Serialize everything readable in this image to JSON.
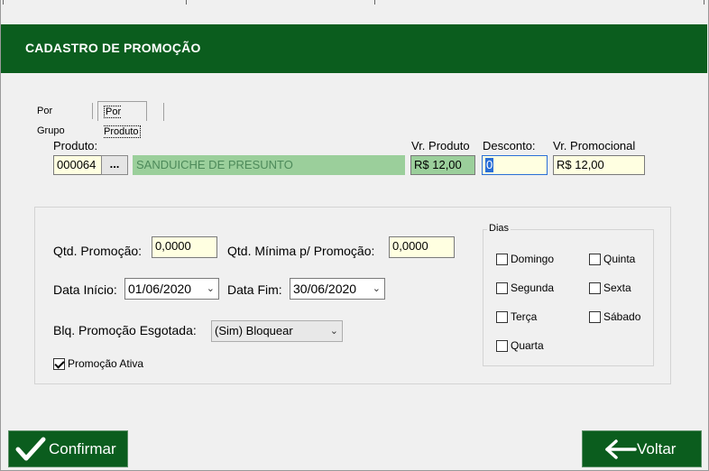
{
  "header": {
    "title": "CADASTRO DE PROMOÇÃO"
  },
  "tabs": [
    {
      "label": "Por Grupo"
    },
    {
      "label": "Por Produto"
    }
  ],
  "produto": {
    "label": "Produto:",
    "code": "000064",
    "lookup_label": "...",
    "name": "SANDUICHE DE PRESUNTO"
  },
  "vr_produto": {
    "label": "Vr. Produto",
    "value": "R$ 12,00"
  },
  "desconto": {
    "label": "Desconto:",
    "value": "0"
  },
  "vr_promocional": {
    "label": "Vr. Promocional",
    "value": "R$ 12,00"
  },
  "qtd_promocao": {
    "label": "Qtd. Promoção:",
    "value": "0,0000"
  },
  "qtd_minima": {
    "label": "Qtd. Mínima p/ Promoção:",
    "value": "0,0000"
  },
  "data_inicio": {
    "label": "Data Início:",
    "value": "01/06/2020"
  },
  "data_fim": {
    "label": "Data Fim:",
    "value": "30/06/2020"
  },
  "blq_promocao": {
    "label": "Blq. Promoção Esgotada:",
    "value": "(Sim) Bloquear"
  },
  "promocao_ativa": {
    "label": "Promoção Ativa",
    "checked": true
  },
  "dias": {
    "label": "Dias",
    "items": [
      {
        "label": "Domingo",
        "checked": false
      },
      {
        "label": "Segunda",
        "checked": false
      },
      {
        "label": "Terça",
        "checked": false
      },
      {
        "label": "Quarta",
        "checked": false
      },
      {
        "label": "Quinta",
        "checked": false
      },
      {
        "label": "Sexta",
        "checked": false
      },
      {
        "label": "Sábado",
        "checked": false
      }
    ]
  },
  "buttons": {
    "confirmar": "Confirmar",
    "voltar": "Voltar"
  },
  "colors": {
    "header_bg": "#0b5d1e",
    "button_bg": "#0b5d1e",
    "readonly_green": "#9bcf9b",
    "input_yellow": "#ffffe1",
    "focus_blue": "#2a6fd6"
  },
  "icons": {
    "confirmar": "checkmark-icon",
    "voltar": "arrow-left-icon",
    "combo": "chevron-down-icon"
  }
}
